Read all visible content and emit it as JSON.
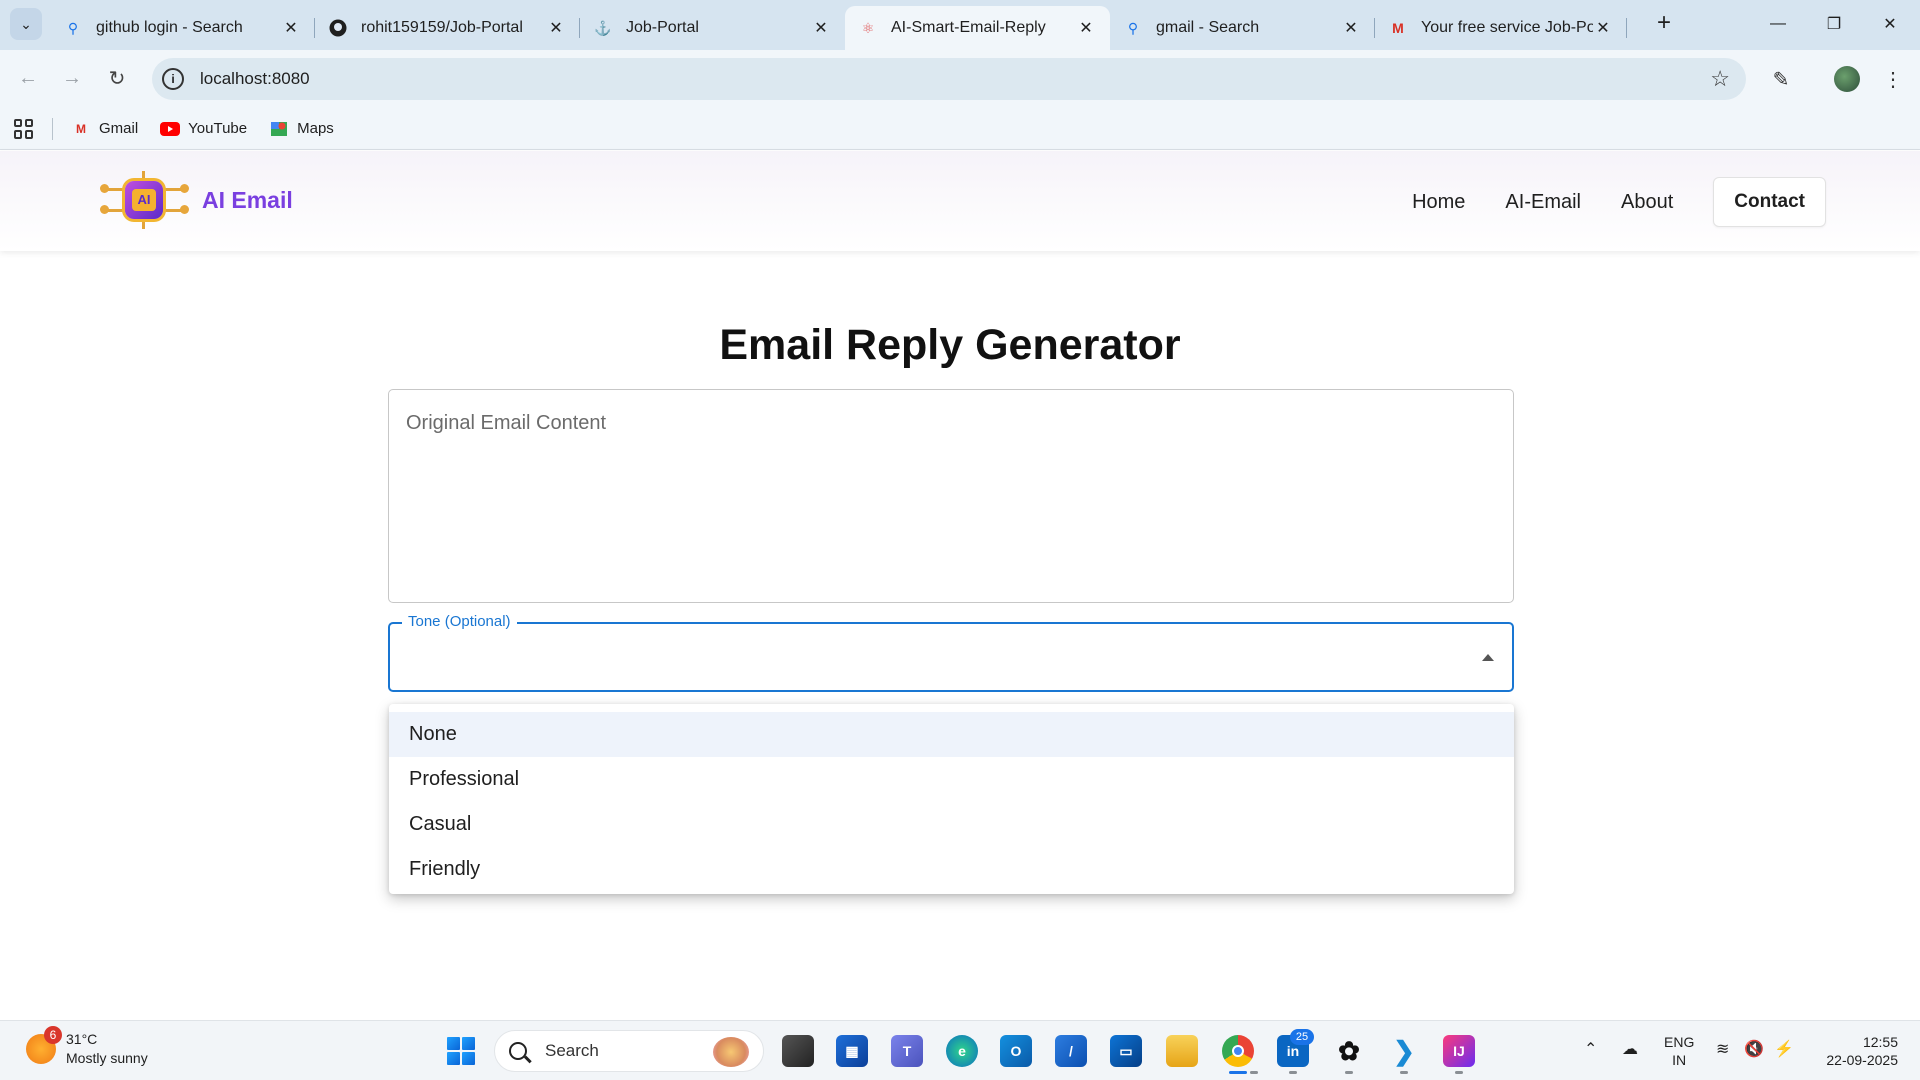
{
  "browser": {
    "tabs": [
      {
        "title": "github login - Search",
        "icon": "search-icon",
        "active": false
      },
      {
        "title": "rohit159159/Job-Portal",
        "icon": "github-icon",
        "active": false
      },
      {
        "title": "Job-Portal",
        "icon": "anchor-icon",
        "active": false
      },
      {
        "title": "AI-Smart-Email-Reply",
        "icon": "react-icon",
        "active": true
      },
      {
        "title": "gmail - Search",
        "icon": "search-icon",
        "active": false
      },
      {
        "title": "Your free service Job-Porta",
        "icon": "gmail-icon",
        "active": false
      }
    ],
    "url": "localhost:8080",
    "bookmarks": [
      {
        "label": "Gmail",
        "icon": "gmail-icon"
      },
      {
        "label": "YouTube",
        "icon": "youtube-icon"
      },
      {
        "label": "Maps",
        "icon": "maps-icon"
      }
    ]
  },
  "app": {
    "brand": "AI Email",
    "logo_text": "AI",
    "nav": {
      "home": "Home",
      "ai_email": "AI-Email",
      "about": "About",
      "contact": "Contact"
    },
    "heading": "Email Reply Generator",
    "email_placeholder": "Original Email Content",
    "tone_label": "Tone (Optional)",
    "tone_options": [
      "None",
      "Professional",
      "Casual",
      "Friendly"
    ],
    "highlighted_option": "None"
  },
  "taskbar": {
    "weather_temp": "31°C",
    "weather_desc": "Mostly sunny",
    "weather_badge": "6",
    "search_label": "Search",
    "linkedin_badge": "25",
    "lang_line1": "ENG",
    "lang_line2": "IN",
    "time": "12:55",
    "date": "22-09-2025"
  }
}
